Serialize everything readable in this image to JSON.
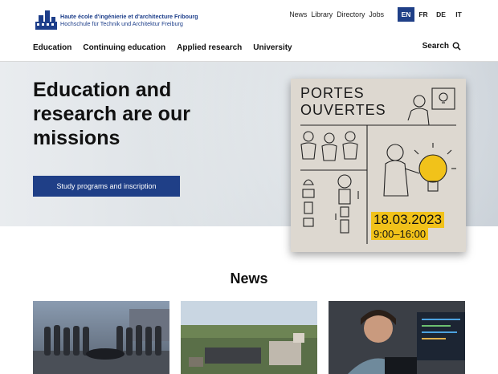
{
  "header": {
    "logo_line1": "Haute école d'ingénierie et d'architecture Fribourg",
    "logo_line2": "Hochschule für Technik und Architektur Freiburg",
    "utility_links": [
      "News",
      "Library",
      "Directory",
      "Jobs"
    ],
    "languages": [
      "EN",
      "FR",
      "DE",
      "IT"
    ],
    "active_language": "EN"
  },
  "nav": {
    "items": [
      "Education",
      "Continuing education",
      "Applied research",
      "University"
    ],
    "search_label": "Search"
  },
  "hero": {
    "title": "Education and research are our missions",
    "button_label": "Study programs and inscription"
  },
  "poster": {
    "title_line1": "PORTES",
    "title_line2": "OUVERTES",
    "date": "18.03.2023",
    "time": "9:00–16:00",
    "accent_color": "#f1c21a"
  },
  "news": {
    "heading": "News"
  },
  "colors": {
    "brand": "#1f3f87",
    "text": "#111111"
  }
}
